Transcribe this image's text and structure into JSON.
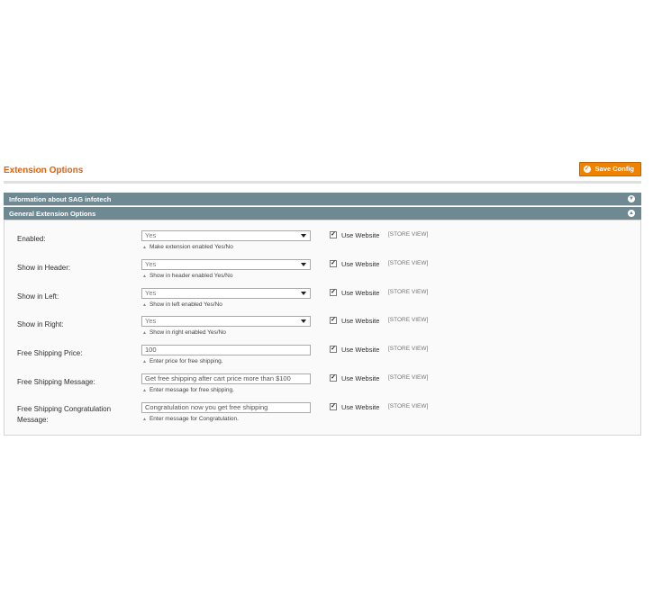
{
  "header": {
    "title": "Extension Options",
    "save_label": "Save Config"
  },
  "sections": [
    {
      "label": "Information about SAG infotech",
      "icon": "expand-icon"
    },
    {
      "label": "General Extension Options",
      "icon": "collapse-icon"
    }
  ],
  "scope": {
    "use_website": "Use Website",
    "store_view": "[STORE VIEW]"
  },
  "fields": [
    {
      "label": "Enabled:",
      "type": "select",
      "value": "Yes",
      "note": "Make extension enabled Yes/No",
      "use_website_checked": true
    },
    {
      "label": "Show in Header:",
      "type": "select",
      "value": "Yes",
      "note": "Show in header enabled Yes/No",
      "use_website_checked": true
    },
    {
      "label": "Show in Left:",
      "type": "select",
      "value": "Yes",
      "note": "Show in left enabled Yes/No",
      "use_website_checked": true
    },
    {
      "label": "Show in Right:",
      "type": "select",
      "value": "Yes",
      "note": "Show in right enabled Yes/No",
      "use_website_checked": true
    },
    {
      "label": "Free Shipping Price:",
      "type": "text",
      "value": "100",
      "note": "Enter price for free shipping.",
      "use_website_checked": true
    },
    {
      "label": "Free Shipping Message:",
      "type": "text",
      "value": "Get free shipping after cart price more than $100",
      "note": "Enter message for free shipping.",
      "use_website_checked": true
    },
    {
      "label": "Free Shipping Congratulation Message:",
      "type": "text",
      "value": "Congratulation now you get free shipping",
      "note": "Enter message for Congratulation.",
      "use_website_checked": true
    }
  ],
  "colors": {
    "accent": "#eb5e00",
    "button": "#f18200",
    "section_header": "#6f8992"
  }
}
